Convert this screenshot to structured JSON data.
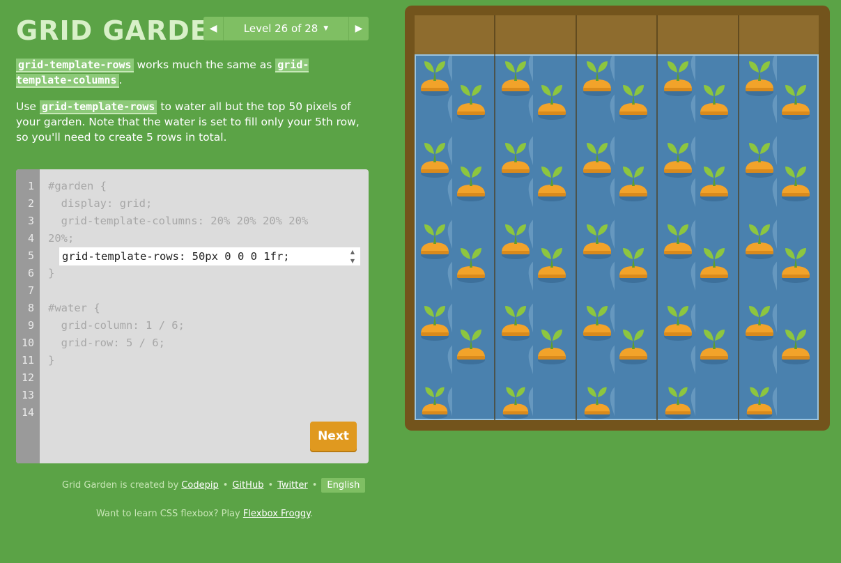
{
  "header": {
    "title": "GRID GARDEN",
    "level_label": "Level 26 of 28",
    "prev_icon": "chevron-left-icon",
    "next_icon": "chevron-right-icon"
  },
  "instructions": {
    "p1_code_a": "grid-template-rows",
    "p1_text_a": " works much the same as ",
    "p1_code_b": "grid-template-columns",
    "p1_text_b": ".",
    "p2_text_a": "Use ",
    "p2_code": "grid-template-rows",
    "p2_text_b": " to water all but the top 50 pixels of your garden. Note that the water is set to fill only your 5th row, so you'll need to create 5 rows in total."
  },
  "editor": {
    "line_numbers": [
      "1",
      "2",
      "3",
      "4",
      "5",
      "6",
      "7",
      "8",
      "9",
      "10",
      "11",
      "12",
      "13",
      "14"
    ],
    "lines": {
      "l1": "#garden {",
      "l2": "  display: grid;",
      "l3": "  grid-template-columns: 20% 20% 20% 20%",
      "l4": "20%;",
      "l6": "}",
      "l8": "#water {",
      "l9": "  grid-column: 1 / 6;",
      "l10": "  grid-row: 5 / 6;",
      "l11": "}"
    },
    "input_value": "grid-template-rows: 50px 0 0 0 1fr;",
    "next_label": "Next"
  },
  "footer": {
    "created_by": "Grid Garden is created by",
    "codepip": "Codepip",
    "github": "GitHub",
    "twitter": "Twitter",
    "language": "English",
    "flexbox_prompt": "Want to learn CSS flexbox? Play ",
    "flexbox_link": "Flexbox Froggy",
    "flexbox_end": "."
  },
  "colors": {
    "background": "#5ba346",
    "water": "#4a81ae",
    "soil": "#8e6c2e",
    "next_button": "#e0991f",
    "carrot": "#f2a32a",
    "leaf": "#8dc63f"
  },
  "icons": {
    "plant": "carrot-sprout-icon"
  }
}
